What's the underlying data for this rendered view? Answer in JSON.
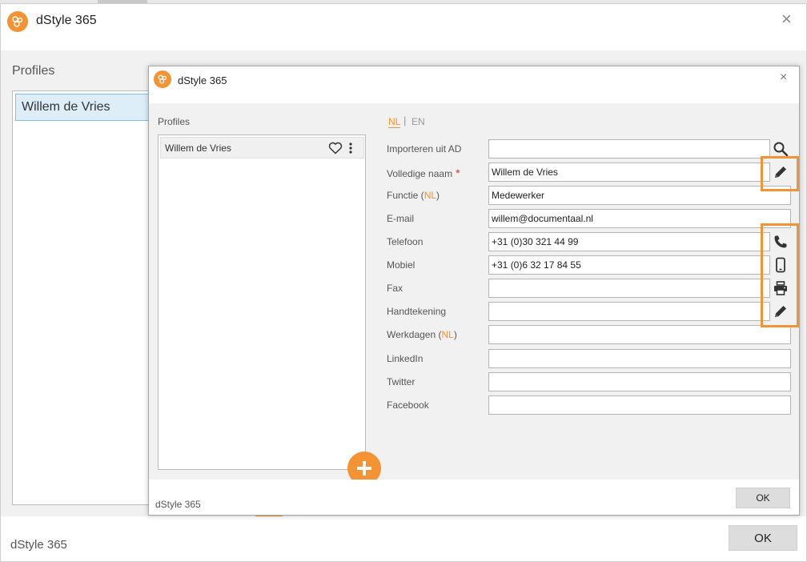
{
  "back_window": {
    "title": "dStyle 365",
    "close_glyph": "×",
    "profiles_label": "Profiles",
    "selected_profile": "Willem de Vries",
    "footer_text": "dStyle 365",
    "ok_label": "OK"
  },
  "front_window": {
    "title": "dStyle 365",
    "close_glyph": "×",
    "profiles_label": "Profiles",
    "profiles": [
      {
        "name": "Willem de Vries"
      }
    ],
    "language_tabs": {
      "active": "NL",
      "separator": "|",
      "inactive": "EN"
    },
    "form": {
      "import_ad": {
        "label": "Importeren uit AD",
        "value": ""
      },
      "full_name": {
        "label": "Volledige naam",
        "required_mark": "*",
        "value": "Willem de Vries"
      },
      "function": {
        "label": "Functie (",
        "lang": "NL",
        "label_end": ")",
        "value": "Medewerker"
      },
      "email": {
        "label": "E-mail",
        "value": "willem@documentaal.nl"
      },
      "phone": {
        "label": "Telefoon",
        "value": "+31 (0)30 321 44 99"
      },
      "mobile": {
        "label": "Mobiel",
        "value": "+31 (0)6 32 17 84 55"
      },
      "fax": {
        "label": "Fax",
        "value": ""
      },
      "signature": {
        "label": "Handtekening",
        "value": ""
      },
      "workdays": {
        "label": "Werkdagen (",
        "lang": "NL",
        "label_end": ")",
        "value": ""
      },
      "linkedin": {
        "label": "LinkedIn",
        "value": ""
      },
      "twitter": {
        "label": "Twitter",
        "value": ""
      },
      "facebook": {
        "label": "Facebook",
        "value": ""
      }
    },
    "footer_text": "dStyle 365",
    "ok_label": "OK"
  },
  "icons": {
    "search": "search-icon",
    "edit": "pencil-icon",
    "phone": "phone-icon",
    "mobile": "mobile-phone-icon",
    "fax": "printer-icon",
    "favorite": "heart-icon",
    "more": "kebab-menu-icon",
    "add": "plus-icon"
  },
  "colors": {
    "accent": "#f39334",
    "required": "#e62a2a",
    "selection_bg": "#ddeef9",
    "selection_border": "#7fc0e6"
  }
}
